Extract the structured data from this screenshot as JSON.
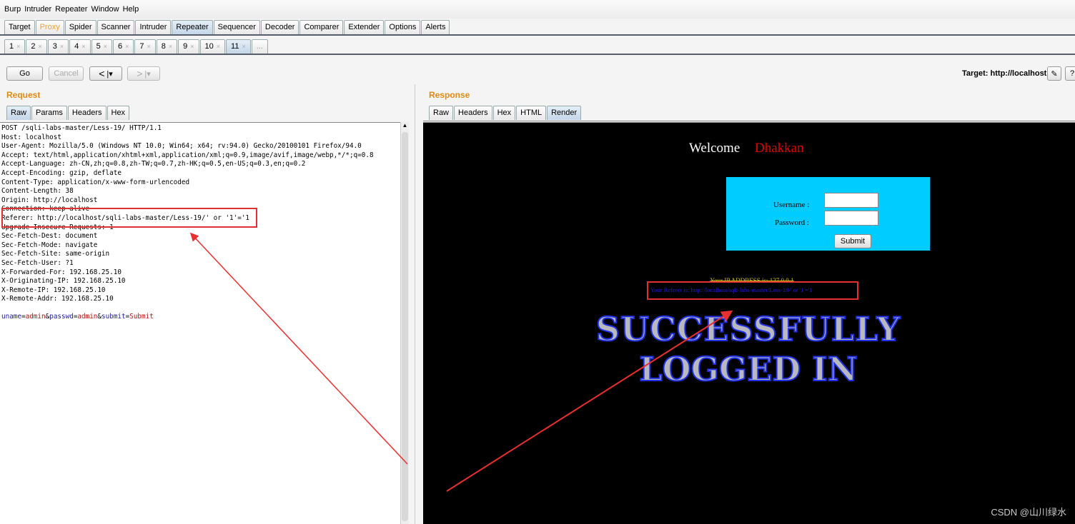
{
  "menu": [
    "Burp",
    "Intruder",
    "Repeater",
    "Window",
    "Help"
  ],
  "main_tabs": [
    "Target",
    "Proxy",
    "Spider",
    "Scanner",
    "Intruder",
    "Repeater",
    "Sequencer",
    "Decoder",
    "Comparer",
    "Extender",
    "Options",
    "Alerts"
  ],
  "repeater_tabs": [
    "1",
    "2",
    "3",
    "4",
    "5",
    "6",
    "7",
    "8",
    "9",
    "10",
    "11"
  ],
  "more_tab": "...",
  "toolbar": {
    "go": "Go",
    "cancel": "Cancel",
    "back": "<",
    "fwd": ">",
    "target": "Target: http://localhost"
  },
  "request": {
    "title": "Request",
    "tabs": [
      "Raw",
      "Params",
      "Headers",
      "Hex"
    ],
    "lines": [
      "POST /sqli-labs-master/Less-19/ HTTP/1.1",
      "Host: localhost",
      "User-Agent: Mozilla/5.0 (Windows NT 10.0; Win64; x64; rv:94.0) Gecko/20100101 Firefox/94.0",
      "Accept: text/html,application/xhtml+xml,application/xml;q=0.9,image/avif,image/webp,*/*;q=0.8",
      "Accept-Language: zh-CN,zh;q=0.8,zh-TW;q=0.7,zh-HK;q=0.5,en-US;q=0.3,en;q=0.2",
      "Accept-Encoding: gzip, deflate",
      "Content-Type: application/x-www-form-urlencoded",
      "Content-Length: 38",
      "Origin: http://localhost",
      "Connection: keep-alive",
      "Referer: http://localhost/sqli-labs-master/Less-19/' or '1'='1",
      "Upgrade-Insecure-Requests: 1",
      "Sec-Fetch-Dest: document",
      "Sec-Fetch-Mode: navigate",
      "Sec-Fetch-Site: same-origin",
      "Sec-Fetch-User: ?1",
      "X-Forwarded-For: 192.168.25.10",
      "X-Originating-IP: 192.168.25.10",
      "X-Remote-IP: 192.168.25.10",
      "X-Remote-Addr: 192.168.25.10"
    ],
    "body": {
      "k1": "uname",
      "v1": "admin",
      "k2": "passwd",
      "v2": "admin",
      "k3": "submit",
      "v3": "Submit"
    }
  },
  "response": {
    "title": "Response",
    "tabs": [
      "Raw",
      "Headers",
      "Hex",
      "HTML",
      "Render"
    ],
    "welcome": "Welcome",
    "name": "Dhakkan",
    "username_label": "Username :",
    "password_label": "Password :",
    "submit": "Submit",
    "ip_text": "Your IP ADDRESS is: 127.0.0.1",
    "referer_text": "Your Referer is: http://localhost/sqli-labs-master/Less-19/' or '1'='1",
    "success1": "SUCCESSFULLY",
    "success2": "LOGGED IN"
  },
  "watermark": "CSDN @山川绿水"
}
